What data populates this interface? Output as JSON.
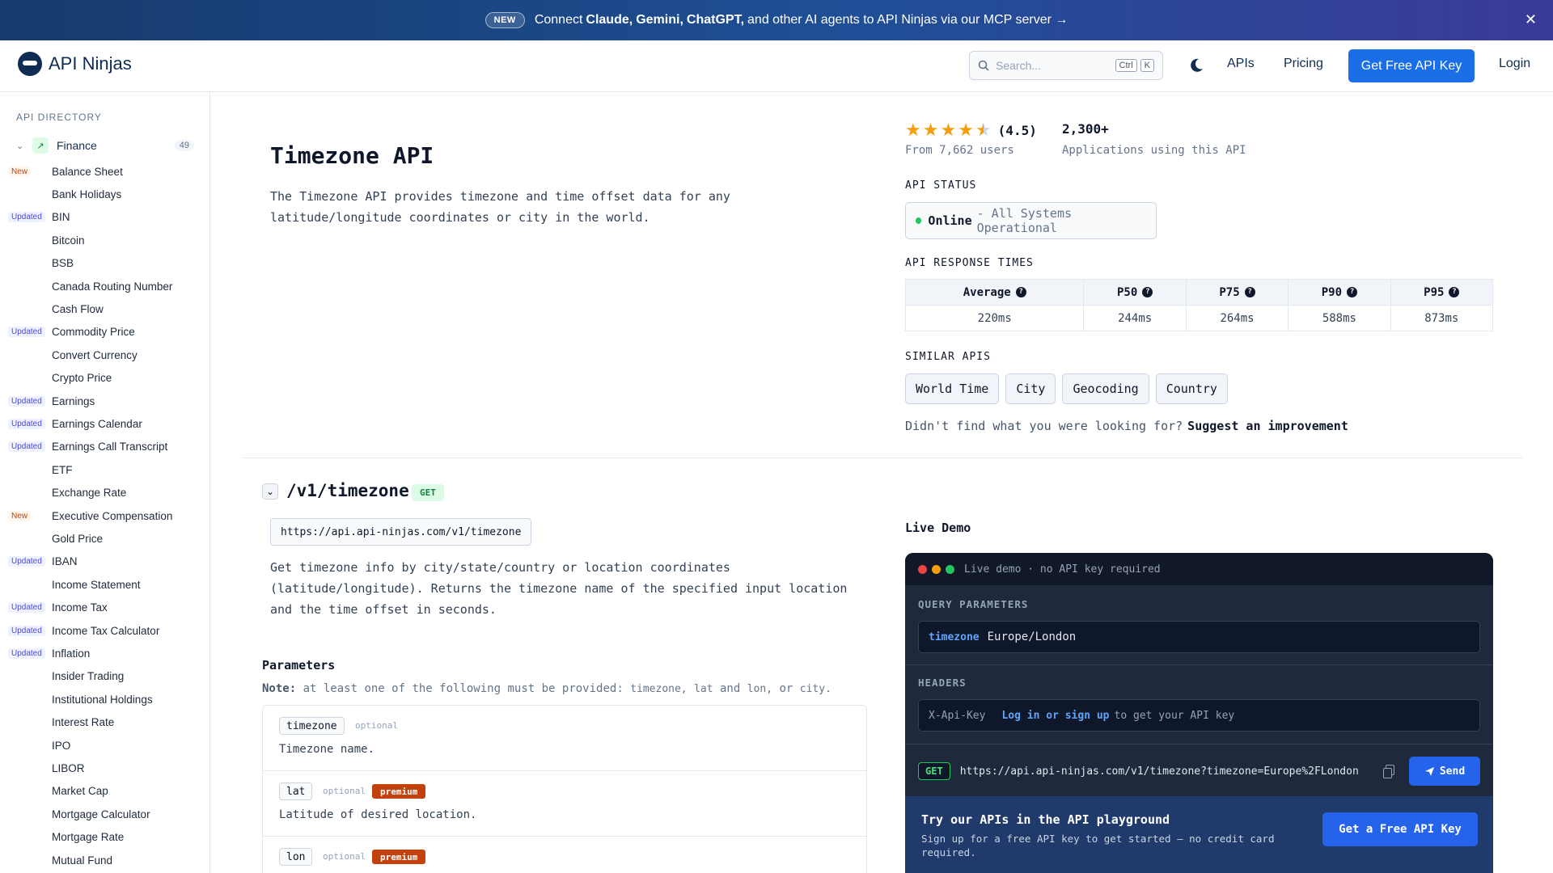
{
  "banner": {
    "badge": "NEW",
    "text_prefix": "Connect",
    "agent1": "Claude,",
    "agent2": "Gemini,",
    "agent3": "ChatGPT,",
    "text_suffix": "and other AI agents to API Ninjas via our MCP server →",
    "close_icon": "close-icon"
  },
  "header": {
    "brand": "API Ninjas",
    "search_placeholder": "Search...",
    "search_kbd1": "Ctrl",
    "search_kbd2": "K",
    "nav_apis": "APIs",
    "nav_pricing": "Pricing",
    "cta": "Get Free API Key",
    "login": "Login"
  },
  "sidebar": {
    "title": "API DIRECTORY",
    "category": {
      "label": "Finance",
      "count": "49"
    },
    "items": [
      {
        "label": "Balance Sheet",
        "tag": "New"
      },
      {
        "label": "Bank Holidays",
        "tag": ""
      },
      {
        "label": "BIN",
        "tag": "Updated"
      },
      {
        "label": "Bitcoin",
        "tag": ""
      },
      {
        "label": "BSB",
        "tag": ""
      },
      {
        "label": "Canada Routing Number",
        "tag": ""
      },
      {
        "label": "Cash Flow",
        "tag": ""
      },
      {
        "label": "Commodity Price",
        "tag": "Updated"
      },
      {
        "label": "Convert Currency",
        "tag": ""
      },
      {
        "label": "Crypto Price",
        "tag": ""
      },
      {
        "label": "Earnings",
        "tag": "Updated"
      },
      {
        "label": "Earnings Calendar",
        "tag": "Updated"
      },
      {
        "label": "Earnings Call Transcript",
        "tag": "Updated"
      },
      {
        "label": "ETF",
        "tag": ""
      },
      {
        "label": "Exchange Rate",
        "tag": ""
      },
      {
        "label": "Executive Compensation",
        "tag": "New"
      },
      {
        "label": "Gold Price",
        "tag": ""
      },
      {
        "label": "IBAN",
        "tag": "Updated"
      },
      {
        "label": "Income Statement",
        "tag": ""
      },
      {
        "label": "Income Tax",
        "tag": "Updated"
      },
      {
        "label": "Income Tax Calculator",
        "tag": "Updated"
      },
      {
        "label": "Inflation",
        "tag": "Updated"
      },
      {
        "label": "Insider Trading",
        "tag": ""
      },
      {
        "label": "Institutional Holdings",
        "tag": ""
      },
      {
        "label": "Interest Rate",
        "tag": ""
      },
      {
        "label": "IPO",
        "tag": ""
      },
      {
        "label": "LIBOR",
        "tag": ""
      },
      {
        "label": "Market Cap",
        "tag": ""
      },
      {
        "label": "Mortgage Calculator",
        "tag": ""
      },
      {
        "label": "Mortgage Rate",
        "tag": ""
      },
      {
        "label": "Mutual Fund",
        "tag": ""
      }
    ]
  },
  "api": {
    "title": "Timezone API",
    "description": "The Timezone API provides timezone and time offset data for any latitude/longitude coordinates or city in the world.",
    "rating_value": 4.5,
    "rating_text": "(4.5)",
    "users_text": "From 7,662 users",
    "apps_count": "2,300+",
    "apps_label": "Applications using this API",
    "status_caption": "API STATUS",
    "status_label": "Online",
    "status_sub": "- All Systems Operational",
    "status_color": "#22c55e",
    "response_caption": "API RESPONSE TIMES",
    "response_headers": [
      "Average",
      "P50",
      "P75",
      "P90",
      "P95"
    ],
    "response_values": [
      "220ms",
      "244ms",
      "264ms",
      "588ms",
      "873ms"
    ],
    "similar_caption": "SIMILAR APIS",
    "similar": [
      "World Time",
      "City",
      "Geocoding",
      "Country"
    ],
    "suggest_text": "Didn't find what you were looking for?",
    "suggest_link": "Suggest an improvement"
  },
  "endpoint": {
    "path": "/v1/timezone",
    "method": "GET",
    "url": "https://api.api-ninjas.com/v1/timezone",
    "description": "Get timezone info by city/state/country or location coordinates (latitude/longitude). Returns the timezone name of the specified input location and the time offset in seconds.",
    "params_title": "Parameters",
    "note_label": "Note:",
    "note_text": "at least one of the following must be provided:",
    "note_p1": "timezone,",
    "note_p2": "lat",
    "note_and": "and",
    "note_p3": "lon,",
    "note_or": "or",
    "note_p4": "city.",
    "params": [
      {
        "name": "timezone",
        "optional": "optional",
        "premium": "",
        "desc": "Timezone name."
      },
      {
        "name": "lat",
        "optional": "optional",
        "premium": "premium",
        "desc": "Latitude of desired location."
      },
      {
        "name": "lon",
        "optional": "optional",
        "premium": "premium",
        "desc": ""
      }
    ]
  },
  "demo": {
    "title": "Live Demo",
    "top_text": "Live demo · no API key required",
    "query_caption": "QUERY PARAMETERS",
    "query_key": "timezone",
    "query_value": "Europe/London",
    "headers_caption": "HEADERS",
    "header_key": "X-Api-Key",
    "header_link": "Log in or sign up",
    "header_text": "to get your API key",
    "method": "GET",
    "request_url": "https://api.api-ninjas.com/v1/timezone?timezone=Europe%2FLondon",
    "send": "Send",
    "promo_title": "Try our APIs in the API playground",
    "promo_sub": "Sign up for a free API key to get started — no credit card required.",
    "promo_button": "Get a Free API Key"
  }
}
